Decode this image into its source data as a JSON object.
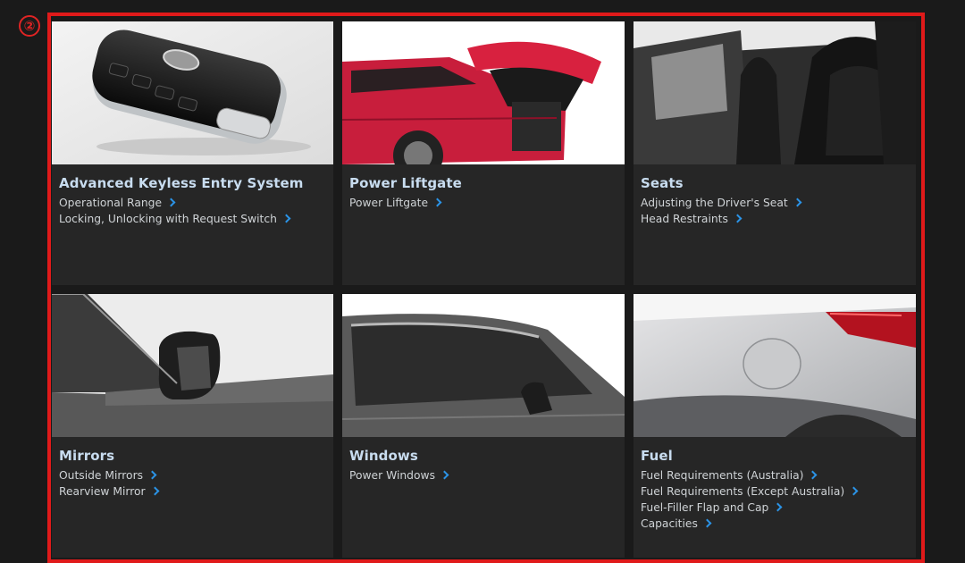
{
  "marker": "②",
  "cards": [
    {
      "title": "Advanced Keyless Entry System",
      "image": "key-fob",
      "links": [
        "Operational Range",
        "Locking, Unlocking with Request Switch"
      ]
    },
    {
      "title": "Power Liftgate",
      "image": "red-suv-liftgate-open",
      "links": [
        "Power Liftgate"
      ]
    },
    {
      "title": "Seats",
      "image": "leather-seats",
      "links": [
        "Adjusting the Driver's Seat",
        "Head Restraints"
      ]
    },
    {
      "title": "Mirrors",
      "image": "side-mirror",
      "links": [
        "Outside Mirrors",
        "Rearview Mirror"
      ]
    },
    {
      "title": "Windows",
      "image": "side-windows",
      "links": [
        "Power Windows"
      ]
    },
    {
      "title": "Fuel",
      "image": "fuel-filler-flap",
      "links": [
        "Fuel Requirements (Australia)",
        "Fuel Requirements (Except Australia)",
        "Fuel-Filler Flap and Cap",
        "Capacities"
      ]
    }
  ],
  "colors": {
    "frame": "#e01a1a",
    "title": "#c8dcef",
    "chevron": "#2b93e6",
    "card": "#262626",
    "background": "#1a1a1a"
  }
}
